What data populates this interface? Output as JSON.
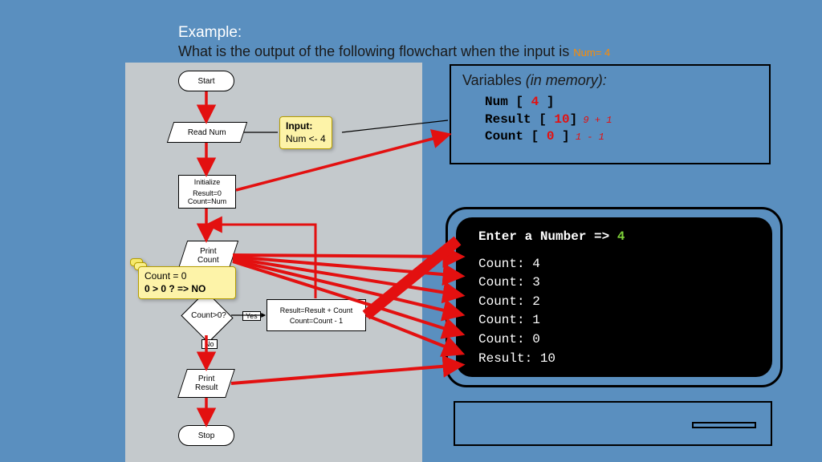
{
  "title": {
    "heading": "Example:",
    "question": "What is the output of the following flowchart when the input is",
    "input_highlight": "Num= 4"
  },
  "flowchart": {
    "start": "Start",
    "read": "Read  Num",
    "init_title": "Initialize",
    "init_l1": "Result=0",
    "init_l2": "Count=Num",
    "print_count_l1": "Print",
    "print_count_l2": "Count",
    "decision": "Count>0?",
    "yes": "Yes",
    "no": "No",
    "body_l1": "Result=Result + Count",
    "body_l2": "Count=Count - 1",
    "print_result_l1": "Print",
    "print_result_l2": "Result",
    "stop": "Stop"
  },
  "stickies": {
    "input_l1": "Input:",
    "input_l2": "Num <- 4",
    "count_l1": "Count = 0",
    "count_l2": "0 > 0 ?  => NO"
  },
  "vars": {
    "title": "Variables",
    "subtitle": "(in memory):",
    "num_label": "Num    [",
    "num_val": " 4 ",
    "num_close": "]",
    "result_label": "Result [",
    "result_val": " 10",
    "result_close": "]",
    "result_calc": "  9 + 1",
    "count_label": "Count  [",
    "count_val": " 0 ",
    "count_close": "]",
    "count_calc": "  1 - 1"
  },
  "terminal": {
    "prompt": "Enter a Number =>",
    "input": "4",
    "lines": [
      "Count: 4",
      "Count: 3",
      "Count: 2",
      "Count: 1",
      "Count: 0",
      "Result: 10"
    ]
  }
}
